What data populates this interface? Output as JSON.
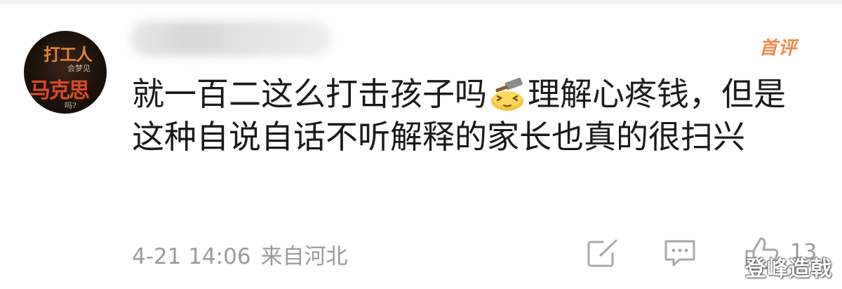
{
  "comment": {
    "avatar": {
      "line1": "打工人",
      "line2": "会梦见",
      "line3": "马克思",
      "line4": "吗?"
    },
    "badge": "首评",
    "text_before_emoji": "就一百二这么打击孩子吗",
    "emoji": "hammer-on-head-emoji",
    "text_after_emoji": "理解心疼钱，但是这种自说自话不听解释的家长也真的很扫兴",
    "date": "4-21 14:06",
    "location": "来自河北",
    "like_count": "13"
  },
  "watermark": "登峰造戟",
  "icons": {
    "share": "share-icon",
    "reply": "comment-icon",
    "like": "thumbs-up-icon"
  },
  "colors": {
    "badge": "#f08a4a",
    "text": "#1a1a1a",
    "meta": "#9a9a9a"
  }
}
